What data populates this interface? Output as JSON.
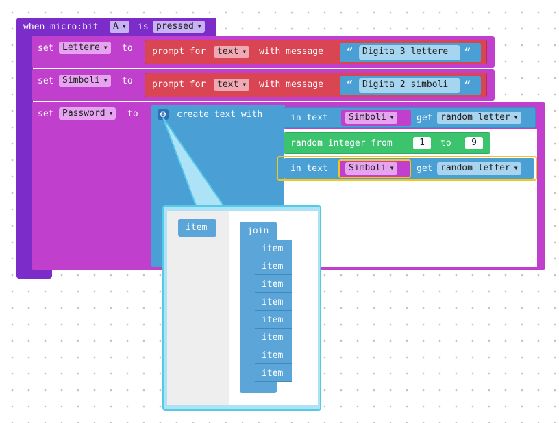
{
  "event_block": {
    "when_label": "when micro:bit",
    "button_value": "A",
    "is_label": "is",
    "state_value": "pressed"
  },
  "set_lettere": {
    "set_label": "set",
    "variable": "Lettere",
    "to_label": "to",
    "prompt_label": "prompt for",
    "type_value": "text",
    "with_message_label": "with message",
    "open_quote": "“",
    "message": "Digita 3 lettere",
    "close_quote": "”"
  },
  "set_simboli": {
    "set_label": "set",
    "variable": "Simboli",
    "to_label": "to",
    "prompt_label": "prompt for",
    "type_value": "text",
    "with_message_label": "with message",
    "open_quote": "“",
    "message": "Digita 2 simboli",
    "close_quote": "”"
  },
  "set_password": {
    "set_label": "set",
    "variable": "Password",
    "to_label": "to",
    "create_text_label": "create text with",
    "row1": {
      "in_text_label": "in text",
      "variable": "Simboli",
      "get_label": "get",
      "where_value": "random letter"
    },
    "row2": {
      "label": "random integer from",
      "from_value": "1",
      "to_label": "to",
      "to_value": "9"
    },
    "row3": {
      "in_text_label": "in text",
      "variable": "Simboli",
      "get_label": "get",
      "where_value": "random letter"
    }
  },
  "mutator": {
    "left_item_label": "item",
    "join_label": "join",
    "items": [
      "item",
      "item",
      "item",
      "item",
      "item",
      "item",
      "item",
      "item"
    ]
  },
  "colors": {
    "event": "#7c2cc9",
    "variables": "#c03fcc",
    "prompt": "#d94552",
    "text": "#4aa0d5",
    "math": "#3bc36e",
    "selected": "#f5c518"
  }
}
